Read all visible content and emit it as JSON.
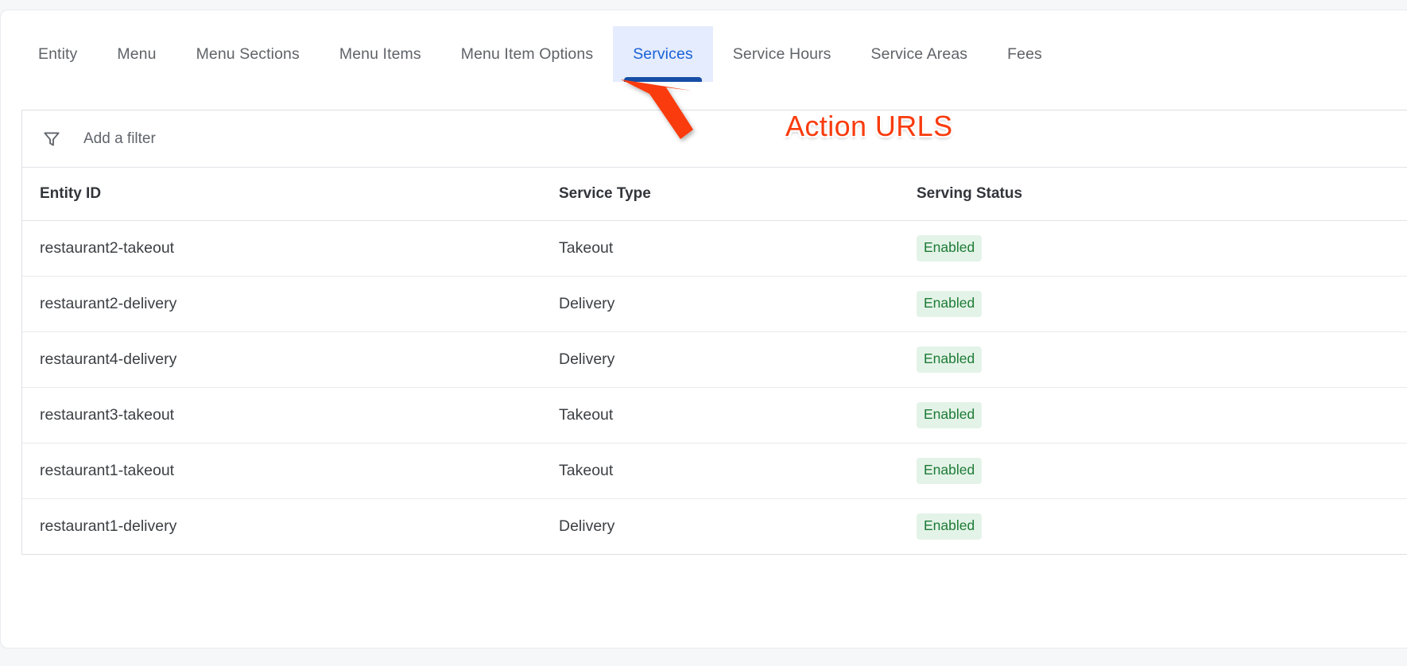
{
  "tabs": [
    {
      "label": "Entity",
      "active": false
    },
    {
      "label": "Menu",
      "active": false
    },
    {
      "label": "Menu Sections",
      "active": false
    },
    {
      "label": "Menu Items",
      "active": false
    },
    {
      "label": "Menu Item Options",
      "active": false
    },
    {
      "label": "Services",
      "active": true
    },
    {
      "label": "Service Hours",
      "active": false
    },
    {
      "label": "Service Areas",
      "active": false
    },
    {
      "label": "Fees",
      "active": false
    }
  ],
  "filter": {
    "placeholder": "Add a filter",
    "value": "",
    "icon": "filter-funnel-icon"
  },
  "table": {
    "columns": [
      "Entity ID",
      "Service Type",
      "Serving Status"
    ],
    "rows": [
      {
        "entity_id": "restaurant2-takeout",
        "service_type": "Takeout",
        "serving_status": "Enabled"
      },
      {
        "entity_id": "restaurant2-delivery",
        "service_type": "Delivery",
        "serving_status": "Enabled"
      },
      {
        "entity_id": "restaurant4-delivery",
        "service_type": "Delivery",
        "serving_status": "Enabled"
      },
      {
        "entity_id": "restaurant3-takeout",
        "service_type": "Takeout",
        "serving_status": "Enabled"
      },
      {
        "entity_id": "restaurant1-takeout",
        "service_type": "Takeout",
        "serving_status": "Enabled"
      },
      {
        "entity_id": "restaurant1-delivery",
        "service_type": "Delivery",
        "serving_status": "Enabled"
      }
    ]
  },
  "annotation": {
    "text": "Action URLS",
    "arrow_icon": "red-arrow-icon",
    "color": "#f93b0d"
  },
  "colors": {
    "accent_blue": "#1a61d8",
    "active_tab_bg": "#e4ecfd",
    "active_tab_underline": "#174ea6",
    "badge_bg": "#e4f3e8",
    "badge_text": "#1c7b35",
    "page_bg": "#f6f7f8",
    "annotation_red": "#f93b0d"
  }
}
